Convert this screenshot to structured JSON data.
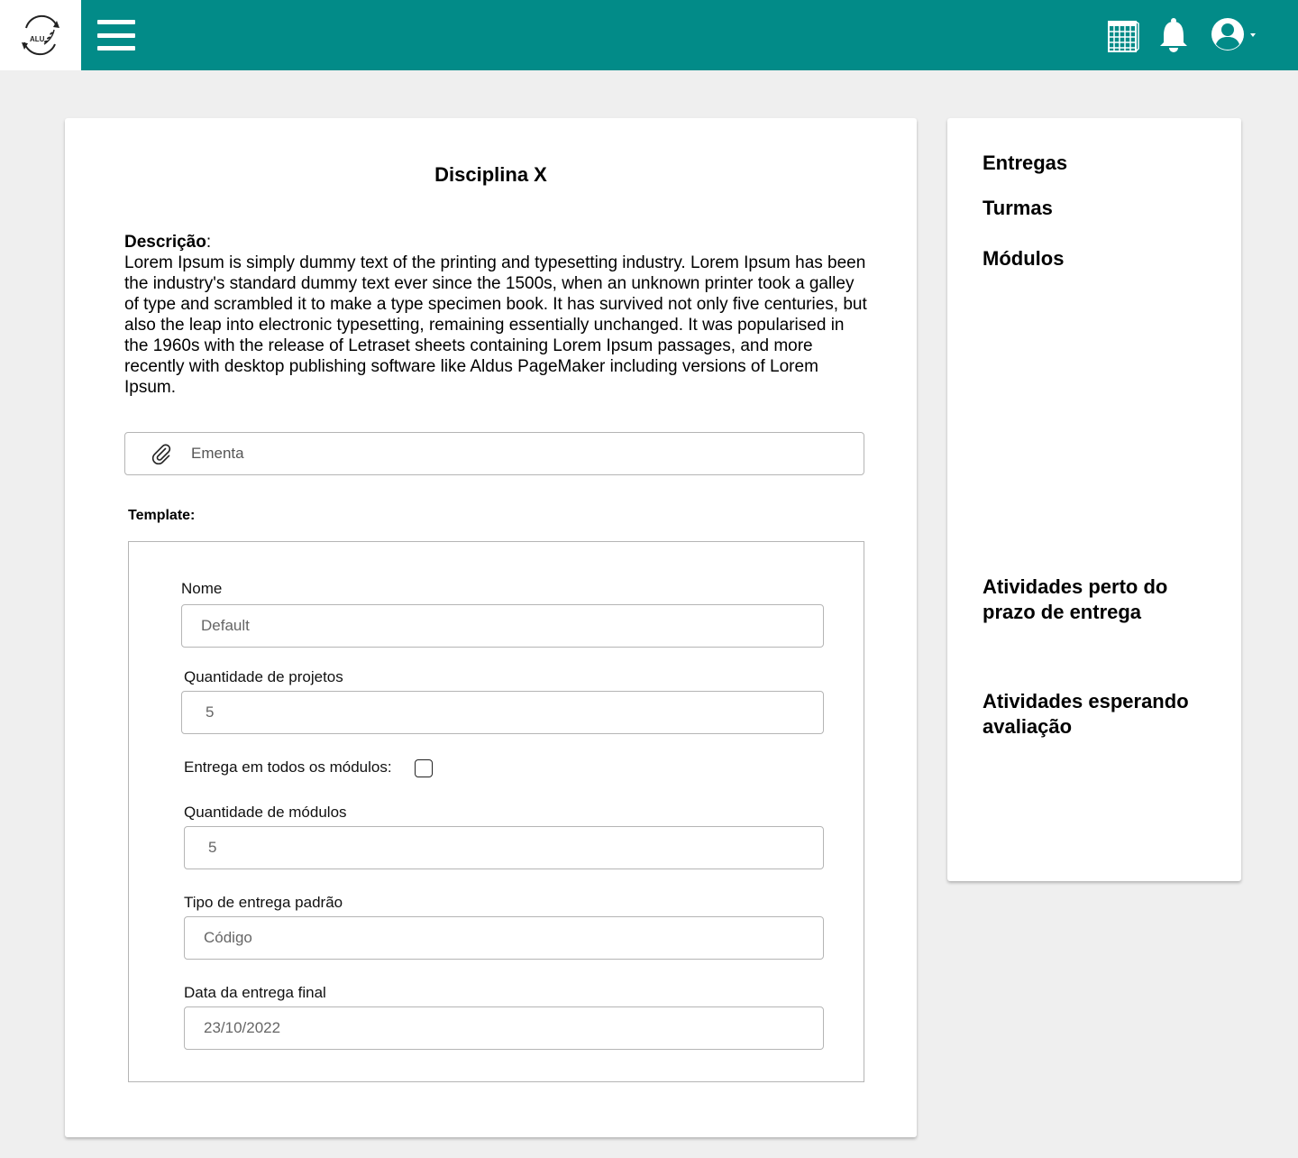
{
  "header": {
    "logo_text": "ALU",
    "icons": [
      "menu-icon",
      "calendar-icon",
      "bell-icon",
      "user-icon",
      "caret-down-icon"
    ],
    "brand_color": "#028b88"
  },
  "main": {
    "title": "Disciplina X",
    "description_label": "Descrição",
    "description_text": "Lorem Ipsum is simply dummy text of the printing and typesetting industry. Lorem Ipsum has been the industry's standard dummy text ever since the 1500s, when an unknown printer took a galley of type and scrambled it to make a type specimen book. It has survived not only five centuries, but also the leap into electronic typesetting, remaining essentially unchanged. It was popularised in the 1960s with the release of Letraset sheets containing Lorem Ipsum passages, and more recently with desktop publishing software like Aldus PageMaker including versions of Lorem Ipsum.",
    "ementa_label": "Ementa",
    "template_label": "Template:",
    "template": {
      "nome_label": "Nome",
      "nome_value": "Default",
      "projetos_label": "Quantidade de projetos",
      "projetos_value": "5",
      "entrega_todos_label": "Entrega em todos os módulos:",
      "entrega_todos_checked": false,
      "modulos_label": "Quantidade de módulos",
      "modulos_value": "5",
      "tipo_label": "Tipo de entrega padrão",
      "tipo_value": "Código",
      "data_label": "Data da entrega final",
      "data_value": "23/10/2022"
    }
  },
  "sidebar": {
    "entregas": "Entregas",
    "turmas": "Turmas",
    "modulos": "Módulos",
    "atividades_prazo": "Atividades perto do prazo de entrega",
    "atividades_avaliacao": "Atividades esperando avaliação"
  }
}
